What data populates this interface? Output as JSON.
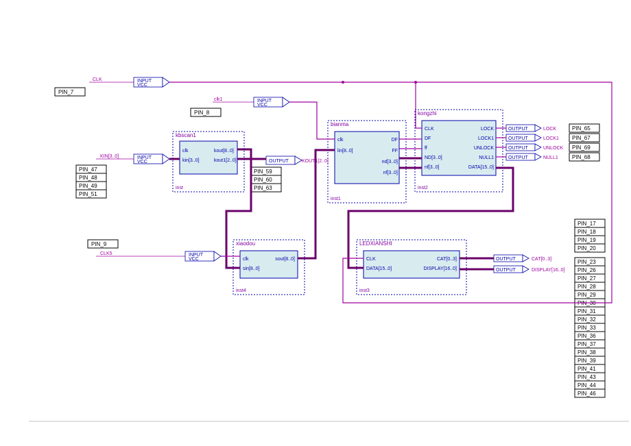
{
  "inputs": {
    "clk": {
      "label": "CLK",
      "io": "INPUT",
      "vcc": "VCC",
      "pin": "PIN_7"
    },
    "clk1": {
      "label": "clk1",
      "io": "INPUT",
      "vcc": "VCC",
      "pin": "PIN_8"
    },
    "kin": {
      "label": "KIN[3..0]",
      "io": "INPUT",
      "vcc": "VCC",
      "pins": [
        "PIN_47",
        "PIN_48",
        "PIN_49",
        "PIN_51"
      ]
    },
    "clk5": {
      "label": "CLK5",
      "io": "INPUT",
      "vcc": "VCC",
      "pin": "PIN_9"
    }
  },
  "outputs": {
    "kout1": {
      "label": "KOUT1[2..0]",
      "io": "OUTPUT",
      "pins": [
        "PIN_59",
        "PIN_60",
        "PIN_63"
      ]
    },
    "lock": {
      "label": "LOCK",
      "io": "OUTPUT",
      "pin": "PIN_65"
    },
    "lock1": {
      "label": "LOCK1",
      "io": "OUTPUT",
      "pin": "PIN_67"
    },
    "unlock": {
      "label": "UNLOCK",
      "io": "OUTPUT",
      "pin": "PIN_69"
    },
    "null1": {
      "label": "NULL1",
      "io": "OUTPUT",
      "pin": "PIN_68"
    },
    "cat": {
      "label": "CAT[0..3]",
      "io": "OUTPUT",
      "pins": [
        "PIN_17",
        "PIN_18",
        "PIN_19",
        "PIN_20"
      ]
    },
    "display": {
      "label": "DISPLAY[16..0]",
      "io": "OUTPUT",
      "pins": [
        "PIN_23",
        "PIN_26",
        "PIN_27",
        "PIN_28",
        "PIN_29",
        "PIN_30",
        "PIN_31",
        "PIN_32",
        "PIN_33",
        "PIN_36",
        "PIN_37",
        "PIN_38",
        "PIN_39",
        "PIN_41",
        "PIN_43",
        "PIN_44",
        "PIN_46"
      ]
    }
  },
  "modules": {
    "kbscan1": {
      "title": "kbscan1",
      "inst": "inst",
      "ports_left": [
        "clk",
        "kin[3..0]"
      ],
      "ports_right": [
        "kout[8..0]",
        "kout1[2..0]"
      ]
    },
    "bianma": {
      "title": "bianma",
      "inst": "inst1",
      "ports_left": [
        "clk",
        "lin[8..0]"
      ],
      "ports_right": [
        "DF",
        "FF",
        "nd[3..0]",
        "nf[3..0]"
      ]
    },
    "kongzhi": {
      "title": "kongzhi",
      "inst": "inst2",
      "ports_left": [
        "CLK",
        "DF",
        "ff",
        "ND[3..0]",
        "nf[3..0]"
      ],
      "ports_right": [
        "LOCK",
        "LOCK1",
        "UNLOCK",
        "NULL1",
        "DATA[15..0]"
      ]
    },
    "xiaodou": {
      "title": "xiaodou",
      "inst": "inst4",
      "ports_left": [
        "clk",
        "sin[8..0]"
      ],
      "ports_right": [
        "sout[8..0]"
      ]
    },
    "ledxianshi": {
      "title": "LEDXIANSHI",
      "inst": "inst3",
      "ports_left": [
        "CLK",
        "DATA[15..0]"
      ],
      "ports_right": [
        "CAT[0..3]",
        "DISPLAY[16..0]"
      ]
    }
  }
}
